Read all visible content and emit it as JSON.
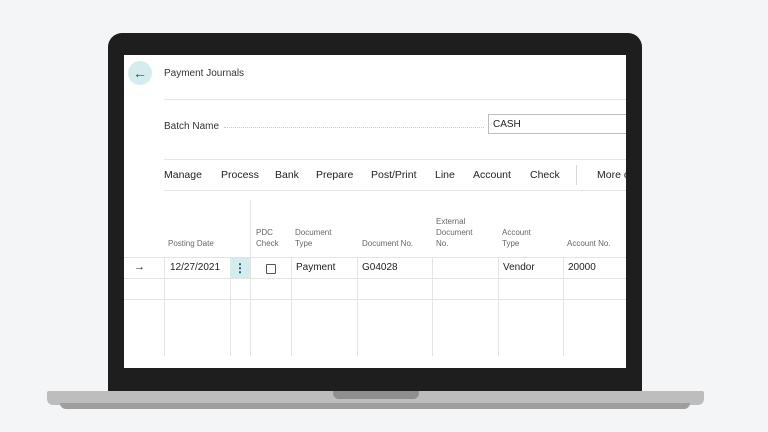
{
  "page": {
    "title": "Payment Journals",
    "back_icon": "back-arrow-icon"
  },
  "batch": {
    "label": "Batch Name",
    "value": "CASH"
  },
  "menu": {
    "items": [
      "Manage",
      "Process",
      "Bank",
      "Prepare",
      "Post/Print",
      "Line",
      "Account",
      "Check"
    ],
    "more_label": "More o"
  },
  "grid": {
    "headers": {
      "posting_date": "Posting Date",
      "pdc_check": "PDC Check",
      "document_type": "Document Type",
      "document_no": "Document No.",
      "external_document_no": "External Document No.",
      "account_type": "Account Type",
      "account_no": "Account No."
    },
    "rows": [
      {
        "posting_date": "12/27/2021",
        "pdc_check": false,
        "document_type": "Payment",
        "document_no": "G04028",
        "external_document_no": "",
        "account_type": "Vendor",
        "account_no": "20000"
      }
    ]
  },
  "colors": {
    "accent": "#d5ecef",
    "accent_text": "#0b5563"
  }
}
